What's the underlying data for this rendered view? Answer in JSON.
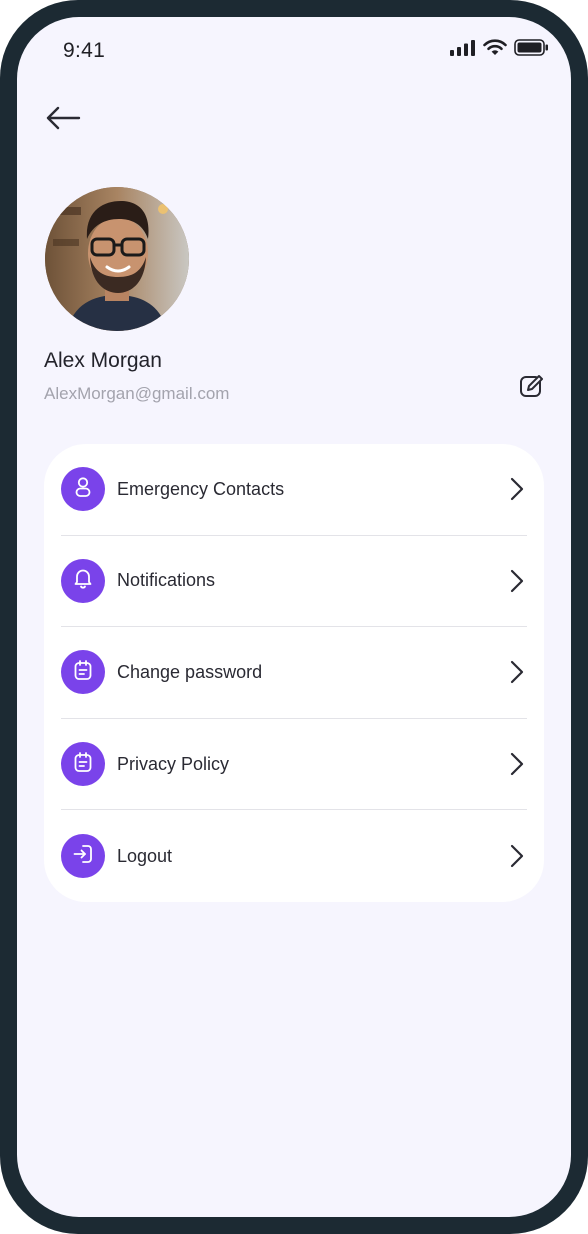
{
  "status_bar": {
    "time": "9:41",
    "icons": [
      "signal-icon",
      "wifi-icon",
      "battery-icon"
    ]
  },
  "header": {
    "back_icon": "arrow-left-icon"
  },
  "profile": {
    "name": "Alex Morgan",
    "email": "AlexMorgan@gmail.com",
    "edit_icon": "edit-pen-icon"
  },
  "menu": {
    "items": [
      {
        "label": "Emergency Contacts",
        "icon": "person-icon"
      },
      {
        "label": "Notifications",
        "icon": "bell-icon"
      },
      {
        "label": "Change password",
        "icon": "clipboard-icon"
      },
      {
        "label": "Privacy Policy",
        "icon": "clipboard-icon"
      },
      {
        "label": "Logout",
        "icon": "logout-icon"
      }
    ]
  },
  "colors": {
    "accent": "#7a43ea",
    "background": "#f6f5fe",
    "frame": "#1c2a33",
    "card": "#ffffff"
  }
}
